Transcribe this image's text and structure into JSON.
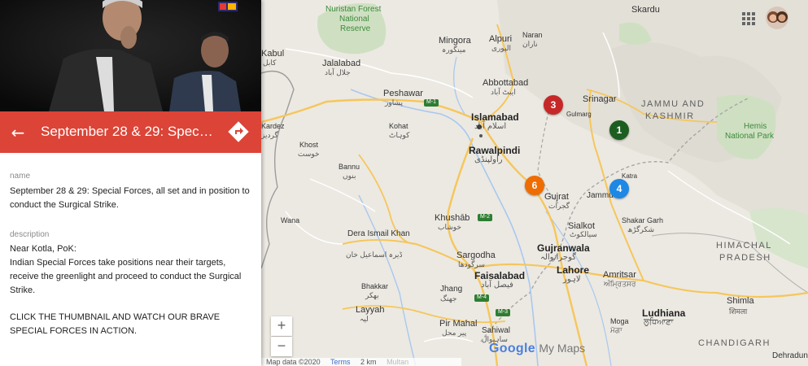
{
  "panel": {
    "title": "September 28 & 29: Special Forces, all set and in position to conduct the Surgical Strike.",
    "name_label": "name",
    "name_value": "September 28 & 29: Special Forces, all set and in position to conduct the Surgical Strike.",
    "description_label": "description",
    "description_lines": [
      "Near Kotla, PoK:",
      "Indian Special Forces take positions near their targets, receive the greenlight and proceed to conduct the Surgical Strike.",
      "",
      "CLICK THE THUMBNAIL AND WATCH OUR BRAVE SPECIAL FORCES IN ACTION."
    ],
    "back_icon": "arrow-left-icon",
    "directions_icon": "directions-icon"
  },
  "map": {
    "cities": [
      {
        "name": "Skardu",
        "urdu": ""
      },
      {
        "name": "Mingora",
        "urdu": "مینگورہ"
      },
      {
        "name": "Alpuri",
        "urdu": "الپوری"
      },
      {
        "name": "Naran",
        "urdu": "ناران"
      },
      {
        "name": "Jalalabad",
        "urdu": "جلال آباد"
      },
      {
        "name": "Abbottabad",
        "urdu": "ایبٹ آباد"
      },
      {
        "name": "Srinagar",
        "urdu": ""
      },
      {
        "name": "Peshawar",
        "urdu": "پشاور"
      },
      {
        "name": "Islamabad",
        "urdu": "اسلام آباد"
      },
      {
        "name": "Gulmarg",
        "urdu": ""
      },
      {
        "name": "Kohat",
        "urdu": "کوہاٹ"
      },
      {
        "name": "Rawalpindi",
        "urdu": "راولپنڈی"
      },
      {
        "name": "Khost",
        "urdu": "خوست"
      },
      {
        "name": "Bannu",
        "urdu": "بنوں"
      },
      {
        "name": "Gujrat",
        "urdu": "گجرات"
      },
      {
        "name": "Jammu",
        "urdu": ""
      },
      {
        "name": "Katra",
        "urdu": ""
      },
      {
        "name": "Khushāb",
        "urdu": "خوشاب"
      },
      {
        "name": "Sialkot",
        "urdu": "سیالکوٹ"
      },
      {
        "name": "Shakar Garh",
        "urdu": "شکرگڑھ"
      },
      {
        "name": "Wana",
        "urdu": ""
      },
      {
        "name": "Dera Ismail Khan",
        "urdu": "ڈیرہ اسماعیل خان"
      },
      {
        "name": "Sargodha",
        "urdu": "سرگودھا"
      },
      {
        "name": "Gujranwala",
        "urdu": "گوجرانوالہ"
      },
      {
        "name": "Faisalabad",
        "urdu": "فیصل آباد"
      },
      {
        "name": "Lahore",
        "urdu": "لاہور"
      },
      {
        "name": "Amritsar",
        "urdu": "ਅੰਮ੍ਰਿਤਸਰ"
      },
      {
        "name": "Jhang",
        "urdu": "جھنگ"
      },
      {
        "name": "Bhakkar",
        "urdu": "بھکر"
      },
      {
        "name": "Layyah",
        "urdu": "لیہ"
      },
      {
        "name": "Pir Mahal",
        "urdu": "پیر محل"
      },
      {
        "name": "Sahiwal",
        "urdu": "ساہیوال"
      },
      {
        "name": "Ludhiana",
        "urdu": "ਲੁਧਿਆਣਾ"
      },
      {
        "name": "Moga",
        "urdu": "ਮੋਗਾ"
      },
      {
        "name": "Shimla",
        "urdu": "शिमला"
      },
      {
        "name": "Dehradun",
        "urdu": ""
      },
      {
        "name": "Kardez",
        "urdu": "گردیز"
      },
      {
        "name": "Kabul",
        "urdu": "کابل"
      }
    ],
    "regions": [
      "JAMMU AND",
      "KASHMIR",
      "HIMACHAL",
      "PRADESH",
      "CHANDIGARH"
    ],
    "parks": [
      "Nuristan Forest",
      "National",
      "Reserve",
      "Hemis",
      "National Park"
    ],
    "highways": [
      "M-1",
      "M-2",
      "M-4",
      "M-3"
    ],
    "markers": [
      {
        "label": "1",
        "color": "#1b5e20"
      },
      {
        "label": "3",
        "color": "#c62828"
      },
      {
        "label": "4",
        "color": "#1e88e5"
      },
      {
        "label": "6",
        "color": "#ef6c00"
      }
    ],
    "zoom_in": "+",
    "zoom_out": "−",
    "footer": {
      "data": "Map data ©2020",
      "terms": "Terms",
      "scale": "2 km",
      "place": "Multan"
    },
    "brand": {
      "google": "Google",
      "mymaps": "My Maps"
    },
    "apps_icon": "apps-grid-icon",
    "avatar_icon": "avatar-icon"
  },
  "colors": {
    "accent": "#db4437",
    "road_major": "#f6c65b",
    "road_minor": "#ffffff",
    "land": "#e9e6df",
    "water": "#a8c8f0",
    "forest": "#cfe0c2"
  }
}
